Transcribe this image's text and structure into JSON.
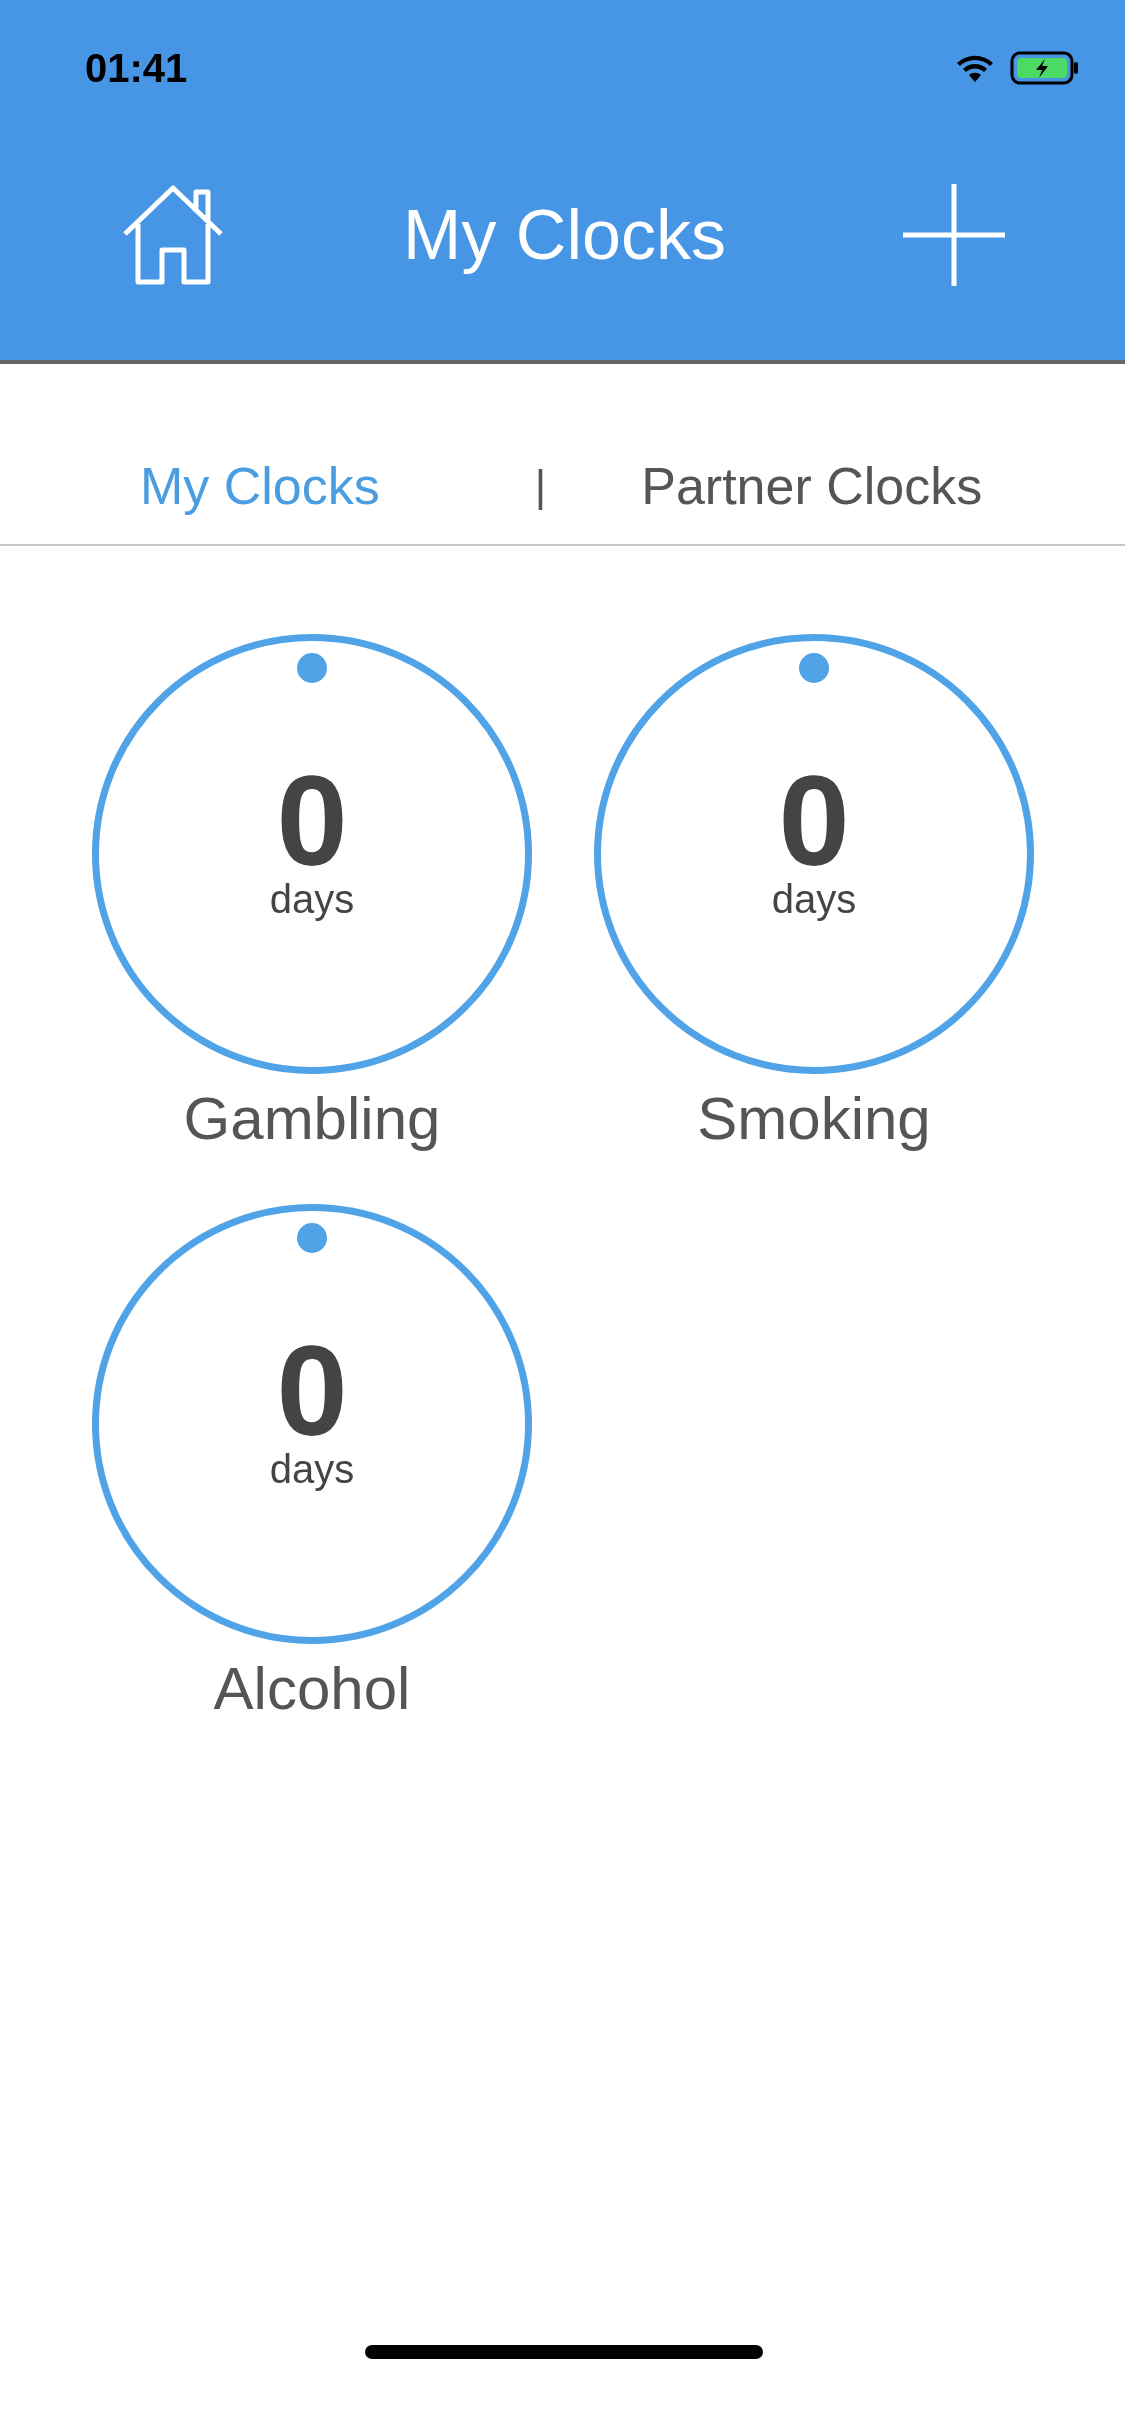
{
  "status_bar": {
    "time": "01:41"
  },
  "header": {
    "title": "My Clocks"
  },
  "tabs": [
    {
      "label": "My Clocks",
      "selected": true
    },
    {
      "label": "Partner Clocks",
      "selected": false
    }
  ],
  "tab_separator": "|",
  "clocks": [
    {
      "count": "0",
      "unit": "days",
      "name": "Gambling"
    },
    {
      "count": "0",
      "unit": "days",
      "name": "Smoking"
    },
    {
      "count": "0",
      "unit": "days",
      "name": "Alcohol"
    }
  ]
}
